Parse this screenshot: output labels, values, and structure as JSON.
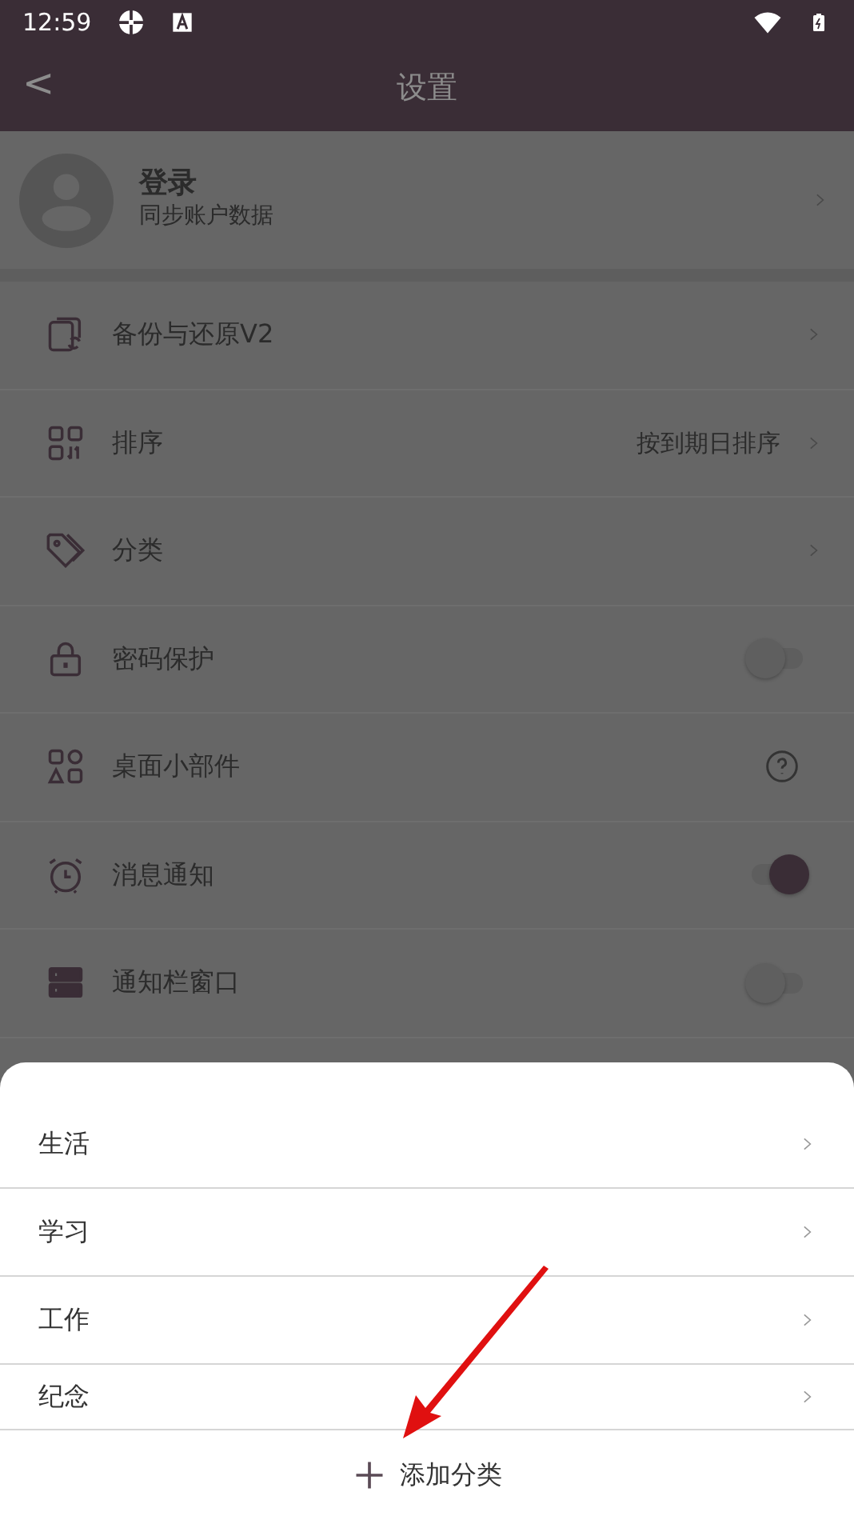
{
  "status_bar": {
    "time": "12:59"
  },
  "header": {
    "back": "<",
    "title": "设置"
  },
  "account": {
    "title": "登录",
    "subtitle": "同步账户数据"
  },
  "settings": [
    {
      "label": "备份与还原V2",
      "kind": "link"
    },
    {
      "label": "排序",
      "kind": "link",
      "value": "按到期日排序"
    },
    {
      "label": "分类",
      "kind": "link"
    },
    {
      "label": "密码保护",
      "kind": "toggle",
      "on": false
    },
    {
      "label": "桌面小部件",
      "kind": "help"
    },
    {
      "label": "消息通知",
      "kind": "toggle",
      "on": true
    },
    {
      "label": "通知栏窗口",
      "kind": "toggle",
      "on": false
    }
  ],
  "sheet": {
    "categories": [
      "生活",
      "学习",
      "工作",
      "纪念"
    ],
    "add_button": "添加分类"
  }
}
